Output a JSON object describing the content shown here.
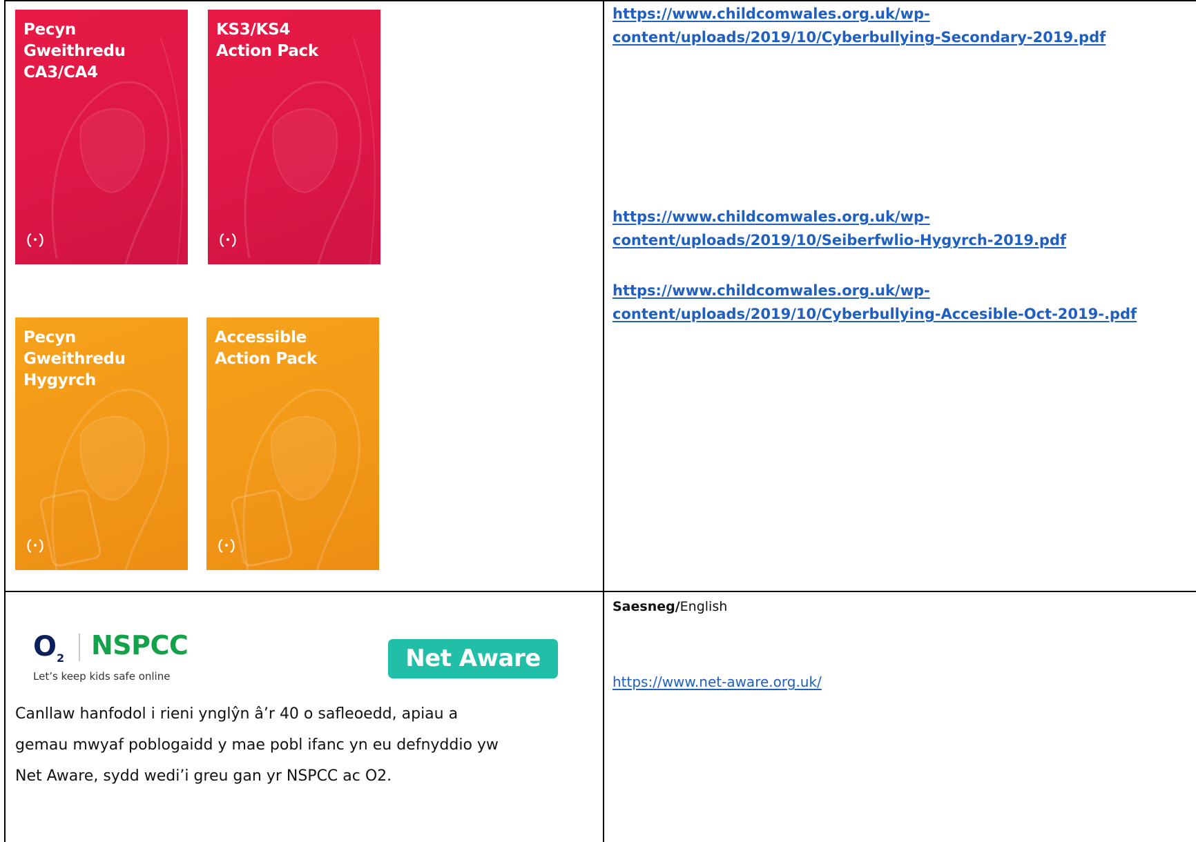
{
  "covers": [
    {
      "title_lines": [
        "Pecyn",
        "Gweithredu",
        "CA3/CA4"
      ],
      "color": "#e31b46"
    },
    {
      "title_lines": [
        "KS3/KS4",
        "Action Pack"
      ],
      "color": "#e31b46"
    },
    {
      "title_lines": [
        "Pecyn",
        "Gweithredu",
        "Hygyrch"
      ],
      "color": "#f39a18"
    },
    {
      "title_lines": [
        "Accessible",
        "Action Pack"
      ],
      "color": "#f39a18"
    }
  ],
  "row1_links": {
    "link1": [
      "https://www.childcomwales.org.uk/wp-",
      "content/uploads/2019/10/Cyberbullying-Secondary-2019.pdf"
    ],
    "link2": [
      "https://www.childcomwales.org.uk/wp-",
      "content/uploads/2019/10/Seiberfwlio-Hygyrch-2019.pdf"
    ],
    "link3": [
      "https://www.childcomwales.org.uk/wp-",
      "content/uploads/2019/10/Cyberbullying-Accesible-Oct-2019-.pdf"
    ]
  },
  "row2": {
    "o2_label": "O",
    "o2_sub": "2",
    "nspcc_label": "NSPCC",
    "tagline": "Let’s keep kids safe online",
    "net_aware_label": "Net Aware",
    "description_lines": [
      "Canllaw hanfodol i rieni ynglŷn â’r 40 o safleoedd, apiau a",
      "gemau mwyaf poblogaidd y mae pobl ifanc yn eu defnyddio yw",
      "Net Aware, sydd wedi’i greu gan yr NSPCC ac O2."
    ],
    "language_bold": "Saesneg/",
    "language_plain": "English",
    "link": "https://www.net-aware.org.uk/"
  },
  "colors": {
    "link": "#1f5fbf",
    "nspcc_green": "#13a24a",
    "net_aware_teal": "#21bfa8",
    "o2_blue": "#0b1f5b"
  }
}
